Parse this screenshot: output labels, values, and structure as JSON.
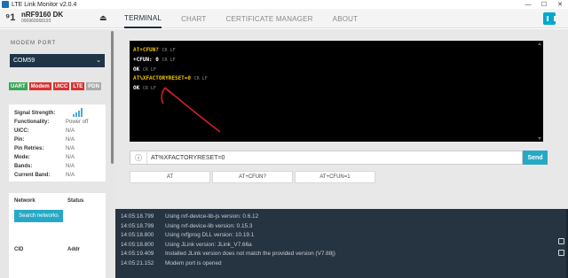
{
  "titlebar": {
    "title": "LTE Link Monitor v2.0.4",
    "minimize": "—",
    "maximize": "☐",
    "close": "✕"
  },
  "device": {
    "name": "nRF9160 DK",
    "serial": "000960068193",
    "eject": "⏏"
  },
  "tabs": [
    {
      "label": "TERMINAL",
      "active": true
    },
    {
      "label": "CHART",
      "active": false
    },
    {
      "label": "CERTIFICATE MANAGER",
      "active": false
    },
    {
      "label": "ABOUT",
      "active": false
    }
  ],
  "sidebar": {
    "modem_port_label": "MODEM PORT",
    "port_value": "COM59",
    "badges": [
      {
        "label": "UART",
        "color": "#3aa657"
      },
      {
        "label": "Modem",
        "color": "#d63333"
      },
      {
        "label": "UICC",
        "color": "#d63333"
      },
      {
        "label": "LTE",
        "color": "#d63333"
      },
      {
        "label": "PDN",
        "color": "#aaaaaa"
      }
    ],
    "status_rows": [
      {
        "key": "Signal Strength:",
        "value": ""
      },
      {
        "key": "Functionality:",
        "value": "Power off"
      },
      {
        "key": "UICC:",
        "value": "N/A"
      },
      {
        "key": "Pin:",
        "value": "N/A"
      },
      {
        "key": "Pin Retries:",
        "value": "N/A"
      },
      {
        "key": "Mode:",
        "value": "N/A"
      },
      {
        "key": "Bands:",
        "value": "N/A"
      },
      {
        "key": "Current Band:",
        "value": "N/A"
      }
    ],
    "network_header": "Network",
    "status_header": "Status",
    "search_button": "Search networks",
    "cid_header": "CID",
    "addr_header": "Addr"
  },
  "terminal": {
    "lines": [
      {
        "text": "AT+CFUN?",
        "type": "cmd",
        "crlf": "CR LF"
      },
      {
        "text": "+CFUN: 0",
        "type": "resp",
        "crlf": "CR LF"
      },
      {
        "text": "OK",
        "type": "resp",
        "crlf": "CR LF"
      },
      {
        "text": "AT%XFACTORYRESET=0",
        "type": "cmd",
        "crlf": "CR LF"
      },
      {
        "text": "OK",
        "type": "resp",
        "crlf": "CR LF"
      }
    ]
  },
  "command": {
    "info_icon": "ⓘ",
    "value": "AT%XFACTORYRESET=0",
    "send_label": "Send"
  },
  "shortcuts": [
    "AT",
    "AT+CFUN?",
    "AT+CFUN=1"
  ],
  "log": [
    {
      "time": "14:05:18.799",
      "message": "Using nrf-device-lib-js version: 0.6.12"
    },
    {
      "time": "14:05:18.799",
      "message": "Using nrf-device-lib version: 0.15.3"
    },
    {
      "time": "14:05:18.800",
      "message": "Using nrfjprog DLL version: 10.19.1"
    },
    {
      "time": "14:05:18.800",
      "message": "Using JLink version: JLink_V7.66a"
    },
    {
      "time": "14:05:19.409",
      "message": "Installed JLink version does not match the provided version (V7.88j)"
    },
    {
      "time": "14:05:21.152",
      "message": "Modem port is opened"
    }
  ]
}
